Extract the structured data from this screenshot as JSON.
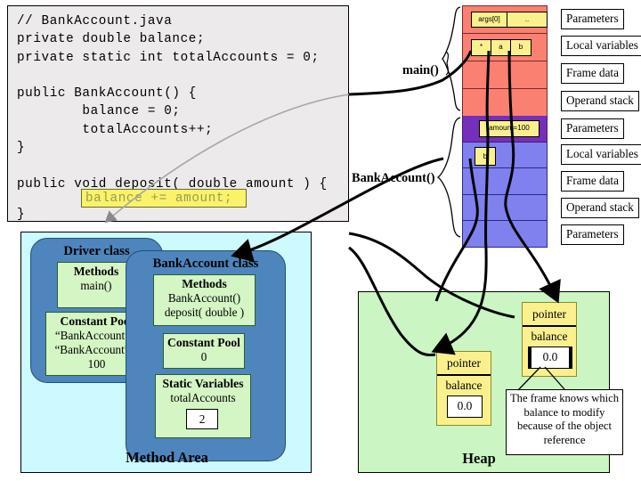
{
  "code_panel": {
    "lines": "// BankAccount.java\nprivate double balance;\nprivate static int totalAccounts = 0;\n\npublic BankAccount() {\n        balance = 0;\n        totalAccounts++;\n}\n\npublic void deposit( double amount ) {",
    "highlighted_line": "balance += amount;",
    "closing_brace": "}",
    "highlight_color": "#faf36a"
  },
  "method_area": {
    "label": "Method Area",
    "background": "#ccfaff",
    "driver_class": {
      "title": "Driver class",
      "methods": {
        "title": "Methods",
        "lines": [
          "main()"
        ]
      },
      "constant_pool": {
        "title": "Constant Pool",
        "lines": [
          "“BankAccount” a",
          "“BankAccount” b",
          "100"
        ]
      }
    },
    "bankaccount_class": {
      "title": "BankAccount class",
      "methods": {
        "title": "Methods",
        "lines": [
          "BankAccount()",
          "deposit( double )"
        ]
      },
      "constant_pool": {
        "title": "Constant Pool",
        "lines": [
          "0"
        ]
      },
      "static_variables": {
        "title": "Static Variables",
        "lines": [
          "totalAccounts"
        ],
        "value": "2"
      }
    }
  },
  "heap": {
    "label": "Heap",
    "background": "#cbf5c2",
    "objects": [
      {
        "pointer_label": "pointer",
        "balance_label": "balance",
        "balance_value": "0.0",
        "highlighted": false
      },
      {
        "pointer_label": "pointer",
        "balance_label": "balance",
        "balance_value": "0.0",
        "highlighted": true
      }
    ],
    "callout": "The frame knows which balance to modify because of the object reference"
  },
  "stack": {
    "frames": [
      {
        "name": "main()",
        "color": "#fa8072",
        "rows": [
          {
            "label": "Parameters",
            "chips": [
              "args[0]",
              ".."
            ]
          },
          {
            "label": "Local variables",
            "chips": [
              "*",
              "a",
              "b"
            ]
          },
          {
            "label": "Frame data",
            "chips": []
          },
          {
            "label": "Operand stack",
            "chips": []
          }
        ]
      },
      {
        "name": "BankAccount()",
        "color": "#8080ee",
        "params_color": "#7430b8",
        "rows": [
          {
            "label": "Parameters",
            "chips": [
              "amount=100"
            ]
          },
          {
            "label": "Local variables",
            "chips": [
              "b"
            ]
          },
          {
            "label": "Frame data",
            "chips": []
          },
          {
            "label": "Operand stack",
            "chips": []
          },
          {
            "label": "Parameters",
            "chips": []
          }
        ]
      }
    ]
  }
}
